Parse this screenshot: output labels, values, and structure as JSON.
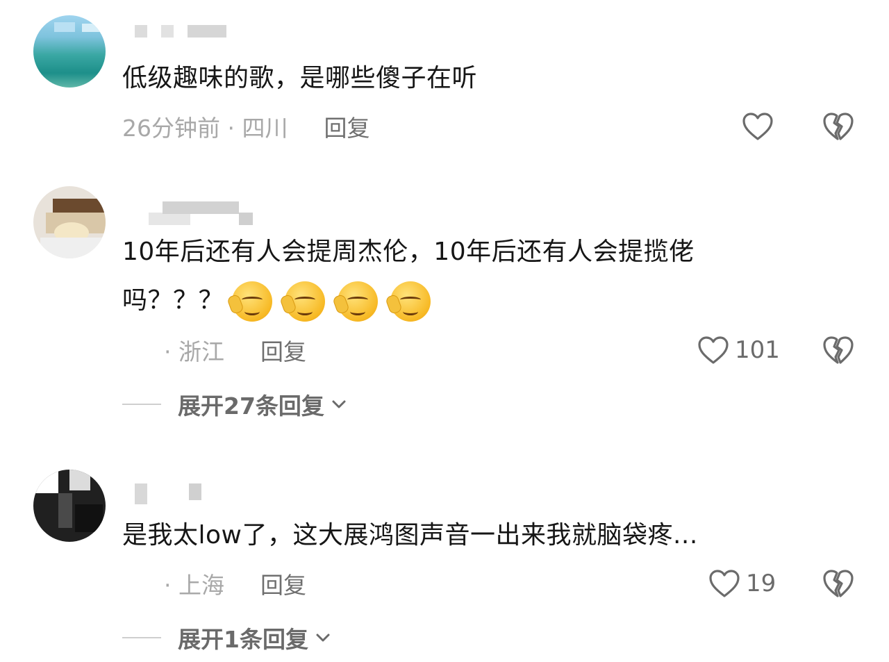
{
  "comments": [
    {
      "text": "低级趣味的歌，是哪些傻子在听",
      "time_location": "26分钟前 · 四川",
      "reply_label": "回复",
      "like_count": ""
    },
    {
      "text_line1": "10年后还有人会提周杰伦，10年后还有人会提揽佬",
      "text_line2": "吗？？？",
      "emoji": [
        "smirk-emoji",
        "smirk-emoji",
        "smirk-emoji",
        "smirk-emoji"
      ],
      "location": "· 浙江",
      "reply_label": "回复",
      "like_count": "101",
      "expand_label": "展开27条回复"
    },
    {
      "text": "是我太low了，这大展鸿图声音一出来我就脑袋疼...",
      "location": "· 上海",
      "reply_label": "回复",
      "like_count": "19",
      "expand_label": "展开1条回复"
    }
  ],
  "colors": {
    "text": "#161616",
    "meta": "#a8a8a8",
    "reply": "#6f6f6f",
    "icon": "#6b6b6b"
  }
}
